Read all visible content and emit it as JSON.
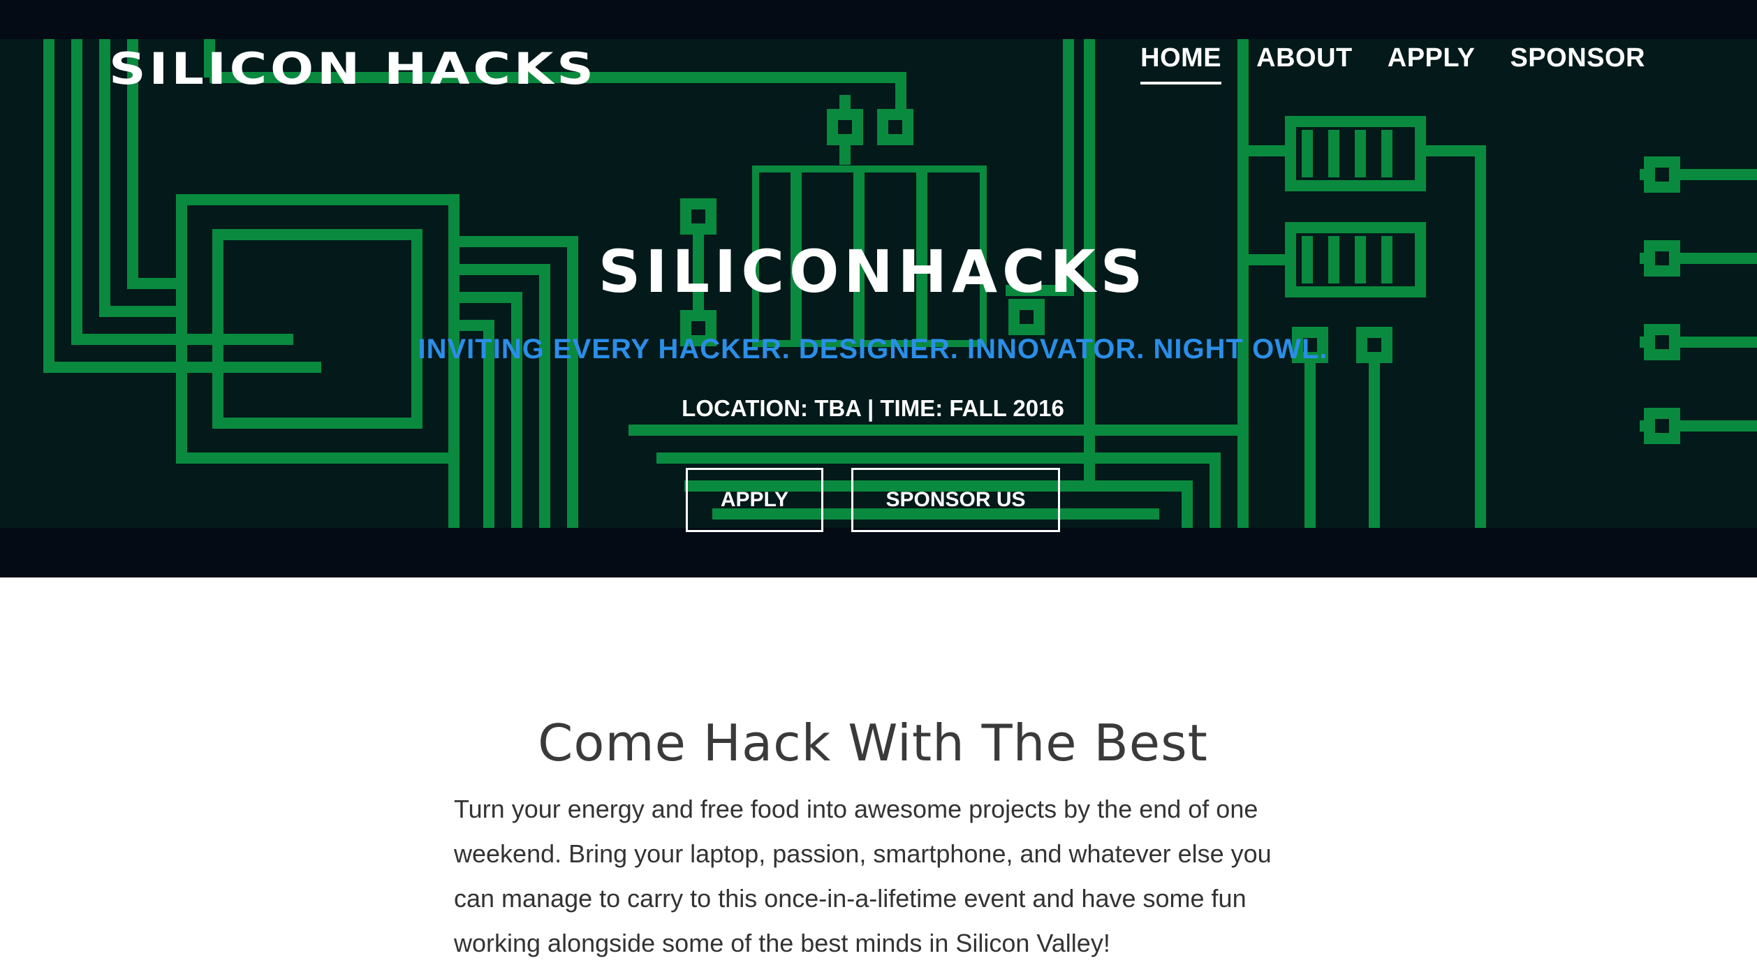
{
  "header": {
    "logo": "SILICON HACKS",
    "nav": [
      {
        "label": "HOME",
        "active": true
      },
      {
        "label": "ABOUT",
        "active": false
      },
      {
        "label": "APPLY",
        "active": false
      },
      {
        "label": "SPONSOR",
        "active": false
      }
    ]
  },
  "hero": {
    "title": "SILICONHACKS",
    "tagline": "INVITING EVERY HACKER. DESIGNER. INNOVATOR. NIGHT OWL.",
    "meta": "LOCATION: TBA | TIME: FALL 2016",
    "buttons": {
      "apply": "APPLY",
      "sponsor": "SPONSOR US"
    }
  },
  "about": {
    "title": "Come Hack With The Best",
    "body": "Turn your energy and free food into awesome projects by the end of one weekend. Bring your laptop, passion, smartphone, and whatever else you can manage to carry to this once-in-a-lifetime event and have some fun working alongside some of the best minds in Silicon Valley!"
  },
  "colors": {
    "tagline": "#2b8ee8",
    "circuit_trace": "#0a8a3e",
    "hero_background": "#03191a"
  }
}
